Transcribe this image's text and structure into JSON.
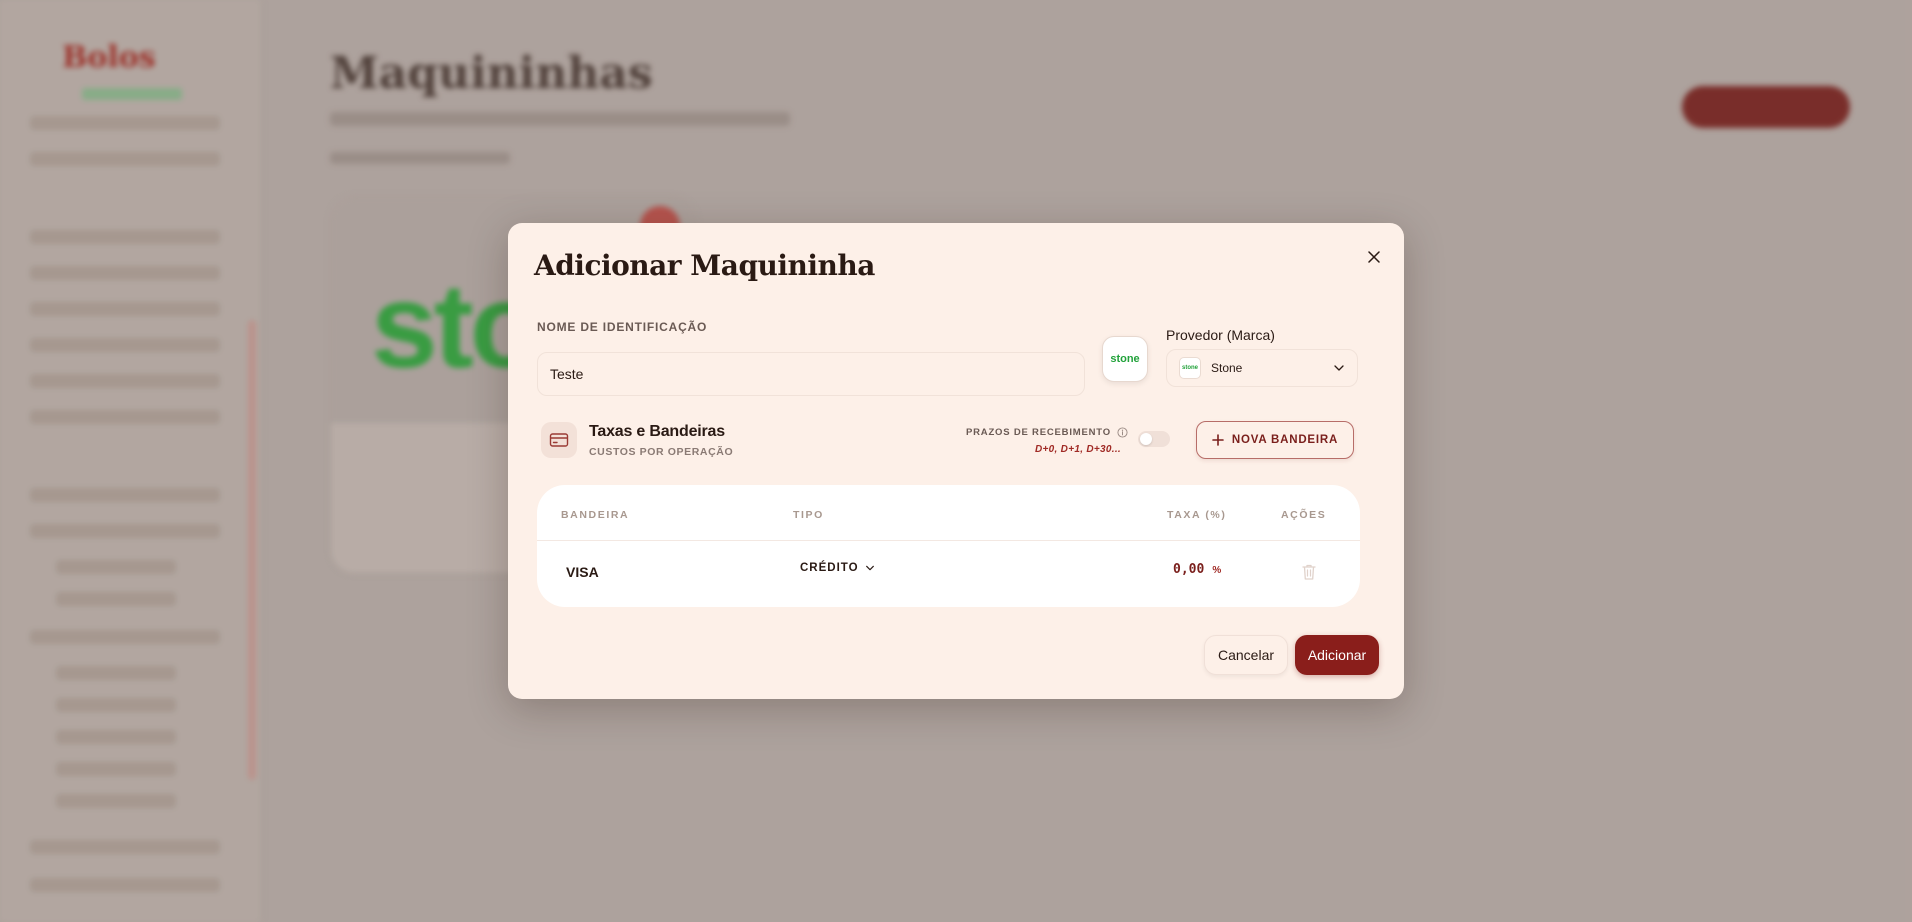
{
  "background": {
    "logo_text": "Bolos",
    "page_title": "Maquininhas",
    "card_brand_text": "sto"
  },
  "modal": {
    "title": "Adicionar Maquininha",
    "name_field": {
      "label": "NOME DE IDENTIFICAÇÃO",
      "value": "Teste"
    },
    "provider": {
      "logo_text": "stone",
      "label": "Provedor (Marca)",
      "selected": "Stone",
      "mini_logo_text": "stone"
    },
    "section": {
      "title": "Taxas e Bandeiras",
      "subtitle": "CUSTOS POR OPERAÇÃO",
      "prazos_label": "PRAZOS DE RECEBIMENTO",
      "prazos_values": "D+0, D+1, D+30...",
      "toggle_on": false,
      "new_button": "NOVA BANDEIRA"
    },
    "table": {
      "headers": [
        "BANDEIRA",
        "TIPO",
        "TAXA (%)",
        "AÇÕES"
      ],
      "rows": [
        {
          "brand": "VISA",
          "type": "CRÉDITO",
          "rate": "0,00",
          "unit": "%"
        }
      ]
    },
    "actions": {
      "cancel": "Cancelar",
      "submit": "Adicionar"
    }
  },
  "colors": {
    "modal_bg": "#fdf0e8",
    "primary": "#8a1e1b",
    "accent_text": "#a02a25",
    "stone_green": "#22a23b"
  }
}
